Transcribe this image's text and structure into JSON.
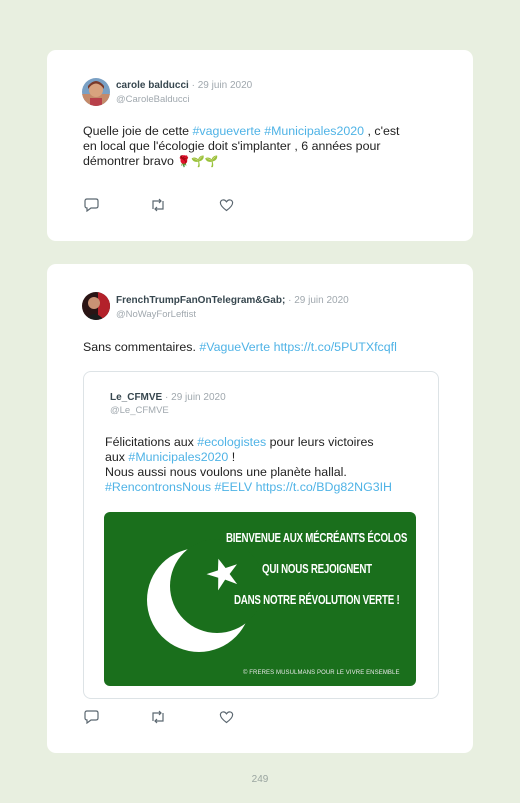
{
  "tweets": [
    {
      "name": "carole balducci",
      "separator": "·",
      "date": "29 juin 2020",
      "handle": "@CaroleBalducci",
      "text_line1_a": "Quelle joie de cette ",
      "text_line1_tag1": "#vagueverte",
      "text_line1_tag2": "#Municipales2020",
      "text_line1_b": " , c'est",
      "text_line2": "en local que l'écologie doit s'implanter , 6 années pour",
      "text_line3": "démontrer bravo ",
      "emoji": "🌹🌱🌱"
    },
    {
      "name": "FrenchTrumpFanOnTelegram&Gab;",
      "separator": "·",
      "date": "29 juin 2020",
      "handle": "@NoWayForLeftist",
      "text_a": "Sans commentaires. ",
      "text_tag": "#VagueVerte",
      "text_link": "https://t.co/5PUTXfcqfl",
      "quote": {
        "name": "Le_CFMVE",
        "separator": "·",
        "date": "29 juin 2020",
        "handle": "@Le_CFMVE",
        "line1_a": "Félicitations aux ",
        "line1_tag": "#ecologistes",
        "line1_b": " pour leurs victoires",
        "line2_a": "aux ",
        "line2_tag": "#Municipales2020",
        "line2_b": " !",
        "line3": "Nous aussi nous voulons une planète hallal.",
        "line4_tag1": "#RencontronsNous",
        "line4_tag2": "#EELV",
        "line4_link": "https://t.co/BDg82NG3IH",
        "image": {
          "line1": "BIENVENUE AUX MÉCRÉANTS ÉCOLOS",
          "line2": "QUI NOUS REJOIGNENT",
          "line3": "DANS NOTRE RÉVOLUTION VERTE !",
          "footer": "© FRERES MUSULMANS POUR LE VIVRE ENSEMBLE"
        }
      }
    }
  ],
  "page_number": "249",
  "icons": [
    "reply-icon",
    "retweet-icon",
    "like-icon"
  ],
  "colors": {
    "hashtag": "#4fb3e6",
    "flag_green": "#1a6f1c",
    "background": "#e8efe0"
  }
}
